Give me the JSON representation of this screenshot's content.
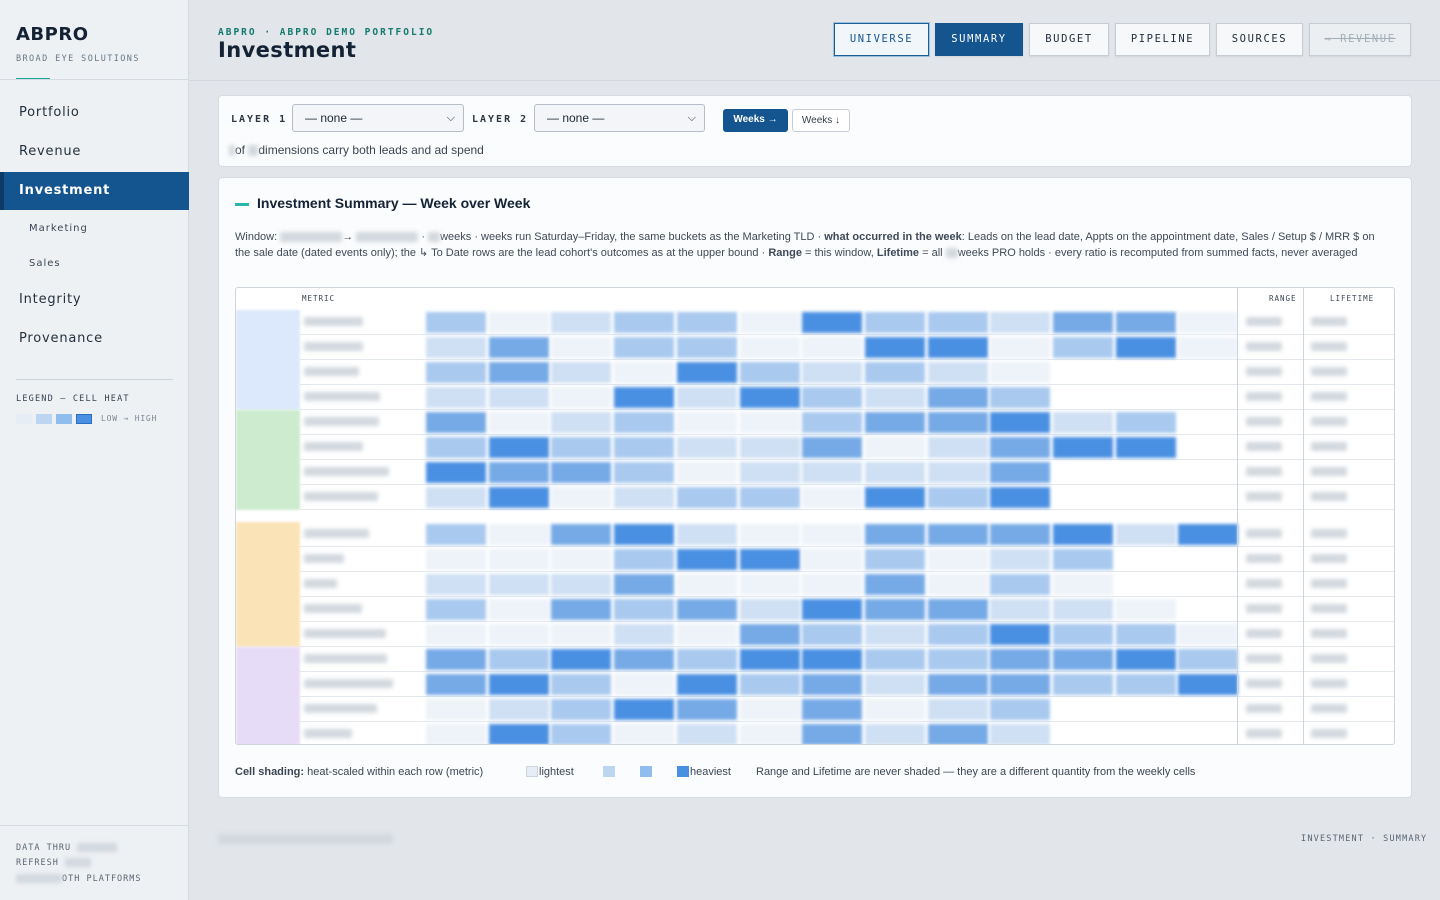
{
  "sidebar": {
    "brand": "ABPRO",
    "brand_sub": "BROAD EYE SOLUTIONS",
    "nav": [
      {
        "label": "Portfolio"
      },
      {
        "label": "Revenue"
      },
      {
        "label": "Investment",
        "active": true
      },
      {
        "label": "Integrity"
      },
      {
        "label": "Provenance"
      }
    ],
    "subnav": [
      {
        "label": "Marketing"
      },
      {
        "label": "Sales"
      }
    ],
    "legend_title": "LEGEND — CELL HEAT",
    "legend_low_high": "LOW → HIGH",
    "legend_colors": [
      "#e6edf5",
      "#bcd6f2",
      "#8fbdee",
      "#4a90e2"
    ],
    "footer": {
      "data_thru": "DATA THRU",
      "refresh": "REFRESH",
      "platforms": "OTH PLATFORMS"
    }
  },
  "header": {
    "crumb": "ABPRO · ABPRO DEMO PORTFOLIO",
    "title": "Investment",
    "buttons": [
      {
        "label": "UNIVERSE",
        "style": "outline"
      },
      {
        "label": "SUMMARY",
        "style": "filled"
      },
      {
        "label": "BUDGET",
        "style": "plain"
      },
      {
        "label": "PIPELINE",
        "style": "plain"
      },
      {
        "label": "SOURCES",
        "style": "plain"
      },
      {
        "label": "→ REVENUE",
        "style": "disabled"
      }
    ]
  },
  "filters": {
    "layer1_label": "LAYER 1",
    "layer1_value": "— none —",
    "layer2_label": "LAYER 2",
    "layer2_value": "— none —",
    "weeks_on": "Weeks →",
    "weeks_off": "Weeks ↓",
    "note_of": "of",
    "note_rest": "dimensions carry both leads and ad spend"
  },
  "summary": {
    "title": "Investment Summary — Week over Week",
    "desc_window": "Window:",
    "desc_arrow": "→",
    "desc_part1": "weeks · weeks run Saturday–Friday, the same buckets as the Marketing TLD ·",
    "desc_bold1": "what occurred in the week",
    "desc_part2": ": Leads on the lead date, Appts on the appointment date, Sales / Setup $ / MRR $ on the sale date (dated events only); the ↳ To Date rows are the lead cohort's outcomes as at the upper bound ·",
    "desc_bold2": "Range",
    "desc_part3": "= this window,",
    "desc_bold3": "Lifetime",
    "desc_part4": "= all",
    "desc_part5": "weeks PRO holds · every ratio is recomputed from summed facts, never averaged",
    "col_metric": "METRIC",
    "col_range": "RANGE",
    "col_lifetime": "LIFETIME",
    "shading_label": "Cell shading:",
    "shading_text": "heat-scaled within each row (metric)",
    "key_lightest": "lightest",
    "key_heaviest": "heaviest",
    "shading_note": "Range and Lifetime are never shaded — they are a different quantity from the weekly cells",
    "group_colors": [
      "#dce8fb",
      "#cdeccf",
      "#fbe3b8",
      "#e7dcf7"
    ]
  },
  "footer_right": "INVESTMENT · SUMMARY"
}
